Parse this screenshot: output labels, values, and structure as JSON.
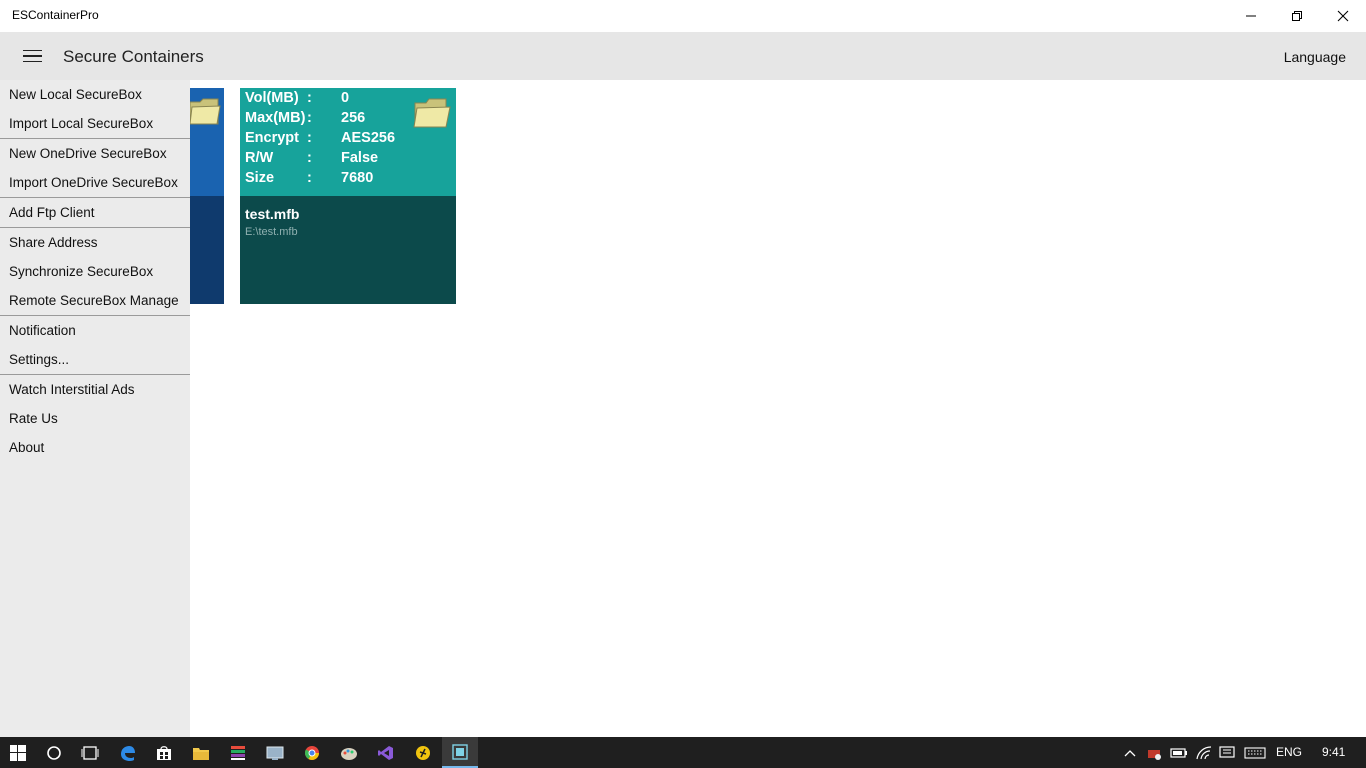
{
  "window": {
    "app_title": "ESContainerPro"
  },
  "header": {
    "page_title": "Secure Containers",
    "language_label": "Language"
  },
  "side_menu": {
    "items": [
      {
        "label": "New Local SecureBox"
      },
      {
        "label": "Import Local SecureBox"
      },
      {
        "label": "New OneDrive SecureBox"
      },
      {
        "label": "Import OneDrive SecureBox"
      },
      {
        "label": "Add Ftp Client"
      },
      {
        "label": "Share Address"
      },
      {
        "label": "Synchronize SecureBox"
      },
      {
        "label": "Remote SecureBox Manage"
      },
      {
        "label": "Notification"
      },
      {
        "label": "Settings..."
      },
      {
        "label": "Watch Interstitial Ads"
      },
      {
        "label": "Rate Us"
      },
      {
        "label": "About"
      }
    ]
  },
  "containers": [
    {
      "color": "#1a63b0"
    },
    {
      "color": "#17a39b",
      "info": [
        {
          "label": "Vol(MB)",
          "colon": ":",
          "value": "0"
        },
        {
          "label": "Max(MB)",
          "colon": ":",
          "value": "256"
        },
        {
          "label": "Encrypt",
          "colon": ":",
          "value": "AES256"
        },
        {
          "label": "R/W",
          "colon": ":",
          "value": "False"
        },
        {
          "label": "Size",
          "colon": ":",
          "value": "7680"
        }
      ],
      "file_name": "test.mfb",
      "file_path": "E:\\test.mfb"
    }
  ],
  "taskbar": {
    "icons": [
      "start-icon",
      "cortana-icon",
      "task-view-icon",
      "edge-icon",
      "store-icon",
      "file-explorer-icon",
      "app-icon-1",
      "app-icon-2",
      "chrome-icon",
      "paint-icon",
      "visual-studio-icon",
      "app-icon-3",
      "escontainerpro-icon"
    ],
    "language": "ENG",
    "clock": "9:41"
  },
  "colors": {
    "accent_teal": "#17a39b",
    "accent_blue": "#1a63b0",
    "header_bg": "#e6e6e6",
    "menu_bg": "#ebebeb"
  }
}
